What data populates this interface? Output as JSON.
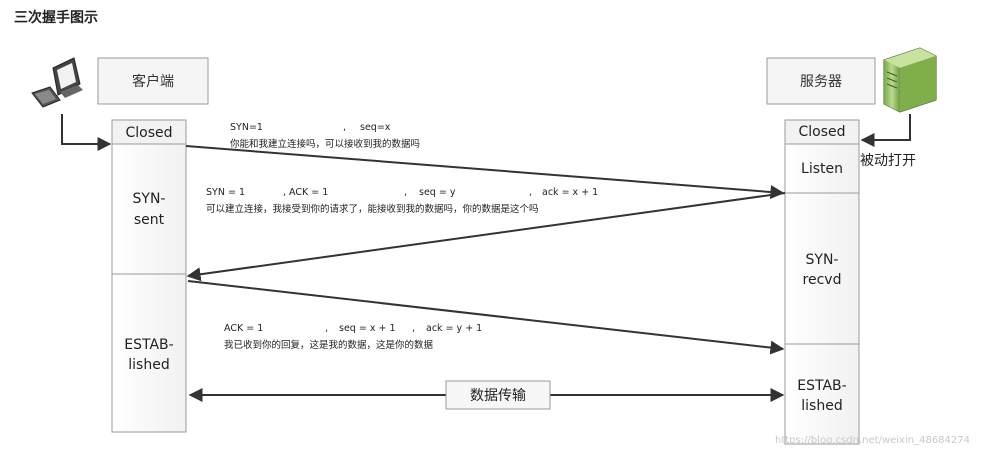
{
  "title": "三次握手图示",
  "client": {
    "label": "客户端"
  },
  "server": {
    "label": "服务器",
    "note": "被动打开"
  },
  "client_states": {
    "closed": "Closed",
    "syn_sent": [
      "SYN-",
      "sent"
    ],
    "established": [
      "ESTAB-",
      "lished"
    ]
  },
  "server_states": {
    "closed": "Closed",
    "listen": "Listen",
    "syn_recvd": [
      "SYN-",
      "recvd"
    ],
    "established": [
      "ESTAB-",
      "lished"
    ]
  },
  "messages": [
    {
      "params": [
        "SYN=1",
        ",",
        "seq=x"
      ],
      "desc": "你能和我建立连接吗，可以接收到我的数据吗"
    },
    {
      "params": [
        "SYN = 1",
        ", ACK = 1",
        ",",
        "seq = y",
        ",",
        "ack = x + 1"
      ],
      "desc": "可以建立连接，我接受到你的请求了，能接收到我的数据吗，你的数据是这个吗"
    },
    {
      "params": [
        "ACK = 1",
        ",",
        "seq = x + 1",
        ",",
        "ack = y + 1"
      ],
      "desc": "我已收到你的回复，这是我的数据，这是你的数据"
    }
  ],
  "transfer": {
    "label": "数据传输"
  },
  "watermark": "https://blog.csdn.net/weixin_48684274"
}
